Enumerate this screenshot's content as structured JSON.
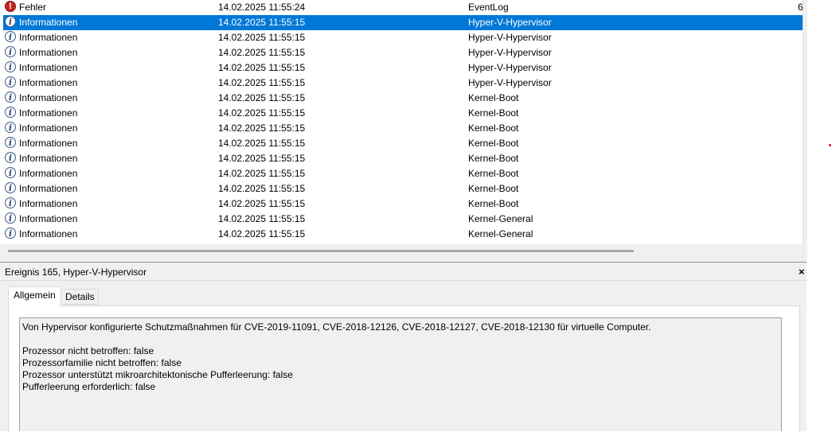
{
  "events": [
    {
      "level": "Fehler",
      "type": "error",
      "date": "14.02.2025 11:55:24",
      "source": "EventLog",
      "id": "6",
      "selected": false
    },
    {
      "level": "Informationen",
      "type": "info",
      "date": "14.02.2025 11:55:15",
      "source": "Hyper-V-Hypervisor",
      "id": "",
      "selected": true
    },
    {
      "level": "Informationen",
      "type": "info",
      "date": "14.02.2025 11:55:15",
      "source": "Hyper-V-Hypervisor",
      "id": "",
      "selected": false
    },
    {
      "level": "Informationen",
      "type": "info",
      "date": "14.02.2025 11:55:15",
      "source": "Hyper-V-Hypervisor",
      "id": "",
      "selected": false
    },
    {
      "level": "Informationen",
      "type": "info",
      "date": "14.02.2025 11:55:15",
      "source": "Hyper-V-Hypervisor",
      "id": "",
      "selected": false
    },
    {
      "level": "Informationen",
      "type": "info",
      "date": "14.02.2025 11:55:15",
      "source": "Hyper-V-Hypervisor",
      "id": "",
      "selected": false
    },
    {
      "level": "Informationen",
      "type": "info",
      "date": "14.02.2025 11:55:15",
      "source": "Kernel-Boot",
      "id": "",
      "selected": false
    },
    {
      "level": "Informationen",
      "type": "info",
      "date": "14.02.2025 11:55:15",
      "source": "Kernel-Boot",
      "id": "",
      "selected": false
    },
    {
      "level": "Informationen",
      "type": "info",
      "date": "14.02.2025 11:55:15",
      "source": "Kernel-Boot",
      "id": "",
      "selected": false
    },
    {
      "level": "Informationen",
      "type": "info",
      "date": "14.02.2025 11:55:15",
      "source": "Kernel-Boot",
      "id": "",
      "selected": false
    },
    {
      "level": "Informationen",
      "type": "info",
      "date": "14.02.2025 11:55:15",
      "source": "Kernel-Boot",
      "id": "",
      "selected": false
    },
    {
      "level": "Informationen",
      "type": "info",
      "date": "14.02.2025 11:55:15",
      "source": "Kernel-Boot",
      "id": "",
      "selected": false
    },
    {
      "level": "Informationen",
      "type": "info",
      "date": "14.02.2025 11:55:15",
      "source": "Kernel-Boot",
      "id": "",
      "selected": false
    },
    {
      "level": "Informationen",
      "type": "info",
      "date": "14.02.2025 11:55:15",
      "source": "Kernel-Boot",
      "id": "",
      "selected": false
    },
    {
      "level": "Informationen",
      "type": "info",
      "date": "14.02.2025 11:55:15",
      "source": "Kernel-General",
      "id": "",
      "selected": false
    },
    {
      "level": "Informationen",
      "type": "info",
      "date": "14.02.2025 11:55:15",
      "source": "Kernel-General",
      "id": "",
      "selected": false
    }
  ],
  "icons": {
    "info": "info-icon",
    "error": "error-icon"
  },
  "colors": {
    "selection": "#0078d7",
    "error": "#c8281e",
    "info_border": "#3c5a87"
  },
  "details": {
    "title": "Ereignis 165, Hyper-V-Hypervisor",
    "close_glyph": "×",
    "tabs": [
      "Allgemein",
      "Details"
    ],
    "active_tab": "Allgemein",
    "lines": [
      "Von Hypervisor konfigurierte Schutzmaßnahmen für CVE-2019-11091, CVE-2018-12126, CVE-2018-12127, CVE-2018-12130 für virtuelle Computer.",
      "",
      "Prozessor nicht betroffen: false",
      "Prozessorfamilie nicht betroffen: false",
      "Prozessor unterstützt mikroarchitektonische Pufferleerung: false",
      "Pufferleerung erforderlich: false"
    ]
  }
}
